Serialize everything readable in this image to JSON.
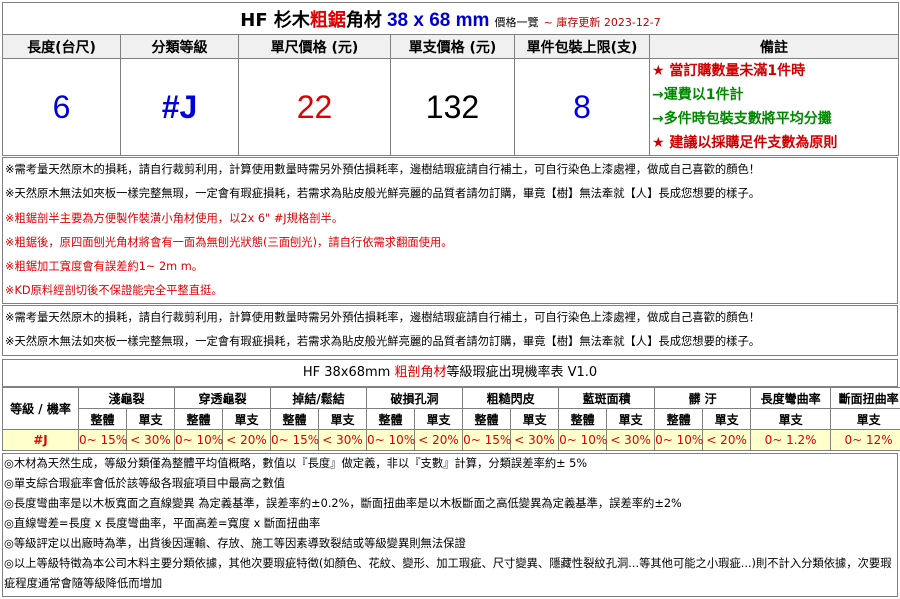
{
  "title": {
    "brand": "HF 杉木",
    "highlight": "粗鋸",
    "product": "角材",
    "size": "38 x 68 mm",
    "suffix": "價格一覽",
    "update": "~ 庫存更新 2023-12-7"
  },
  "headers": [
    "長度(台尺)",
    "分類等級",
    "單尺價格 (元)",
    "單支價格 (元)",
    "單件包裝上限(支)",
    "備註"
  ],
  "values": {
    "length": "6",
    "grade": "#J",
    "price_per_foot": "22",
    "price_per_piece": "132",
    "bundle_max": "8"
  },
  "remarks": [
    "★ 當訂購數量未滿1件時",
    "→運費以1件計",
    "→多件時包裝支數將平均分攤",
    "★ 建議以採購足件支數為原則"
  ],
  "notices_1": [
    "※需考量天然原木的損耗，請自行裁剪利用，計算使用數量時需另外預估損耗率，邊樹結瑕疵請自行補土，可自行染色上漆處裡，做成自己喜歡的顏色！",
    "※天然原木無法如夾板一樣完整無瑕，一定會有瑕疵損耗，若需求為貼皮般光鮮亮麗的品質者請勿訂購，畢竟【樹】無法牽就【人】長成您想要的樣子。",
    "※粗鋸剖半主要為方便製作裝潢小角材使用，以2x 6\" #J規格剖半。",
    "※粗鋸後，原四面刨光角材將會有一面為無刨光狀態(三面刨光)，請自行依需求翻面使用。",
    "※粗鋸加工寬度會有誤差約1~ 2m m。",
    "※KD原料經剖切後不保證能完全平整直挺。"
  ],
  "notices_2": [
    "※需考量天然原木的損耗，請自行裁剪利用，計算使用數量時需另外預估損耗率，邊樹結瑕疵請自行補土，可自行染色上漆處裡，做成自己喜歡的顏色！",
    "※天然原木無法如夾板一樣完整無瑕，一定會有瑕疵損耗，若需求為貼皮般光鮮亮麗的品質者請勿訂購，畢竟【樹】無法牽就【人】長成您想要的樣子。"
  ],
  "defect_table": {
    "title_prefix": "HF 38x68mm ",
    "title_highlight": "粗剖角材",
    "title_suffix": "等級瑕疵出現機率表 V1.0",
    "grade_header": "等級 / 機率",
    "categories": [
      "淺龜裂",
      "穿透龜裂",
      "掉結/鬆結",
      "破損孔洞",
      "粗糙閃皮",
      "藍斑面積",
      "髒 汙",
      "長度彎曲率",
      "斷面扭曲率"
    ],
    "sub_whole": "整體",
    "sub_single": "單支",
    "row_grade": "#J",
    "row_values": [
      "0~ 15%",
      "< 30%",
      "0~ 10%",
      "< 20%",
      "0~ 15%",
      "< 30%",
      "0~ 10%",
      "< 20%",
      "0~ 15%",
      "< 30%",
      "0~ 10%",
      "< 30%",
      "0~ 10%",
      "< 20%",
      "0~ 1.2%",
      "0~ 12%"
    ]
  },
  "footnotes": [
    "◎木材為天然生成，等級分類僅為整體平均值概略，數值以『長度』做定義，非以『支數』計算，分類誤差率約± 5%",
    "◎單支綜合瑕疵率會低於該等級各瑕疵項目中最高之數值",
    "◎長度彎曲率是以木板寬面之直線變異 為定義基準，誤差率約±0.2%，斷面扭曲率是以木板斷面之高低變異為定義基準，誤差率約±2%",
    "◎直線彎差=長度 x 長度彎曲率，平面高差=寬度 x 斷面扭曲率",
    "◎等級評定以出廠時為準，出貨後因運輸、存放、施工等因素導致裂結或等級變異則無法保證",
    "◎以上等級特徵為本公司木料主要分類依據，其他次要瑕疵特徵(如顏色、花紋、變形、加工瑕疵、尺寸變異、隱藏性裂紋孔洞...等其他可能之小瑕疵...)則不計入分類依據，次要瑕疵程度通常會隨等級降低而增加"
  ]
}
